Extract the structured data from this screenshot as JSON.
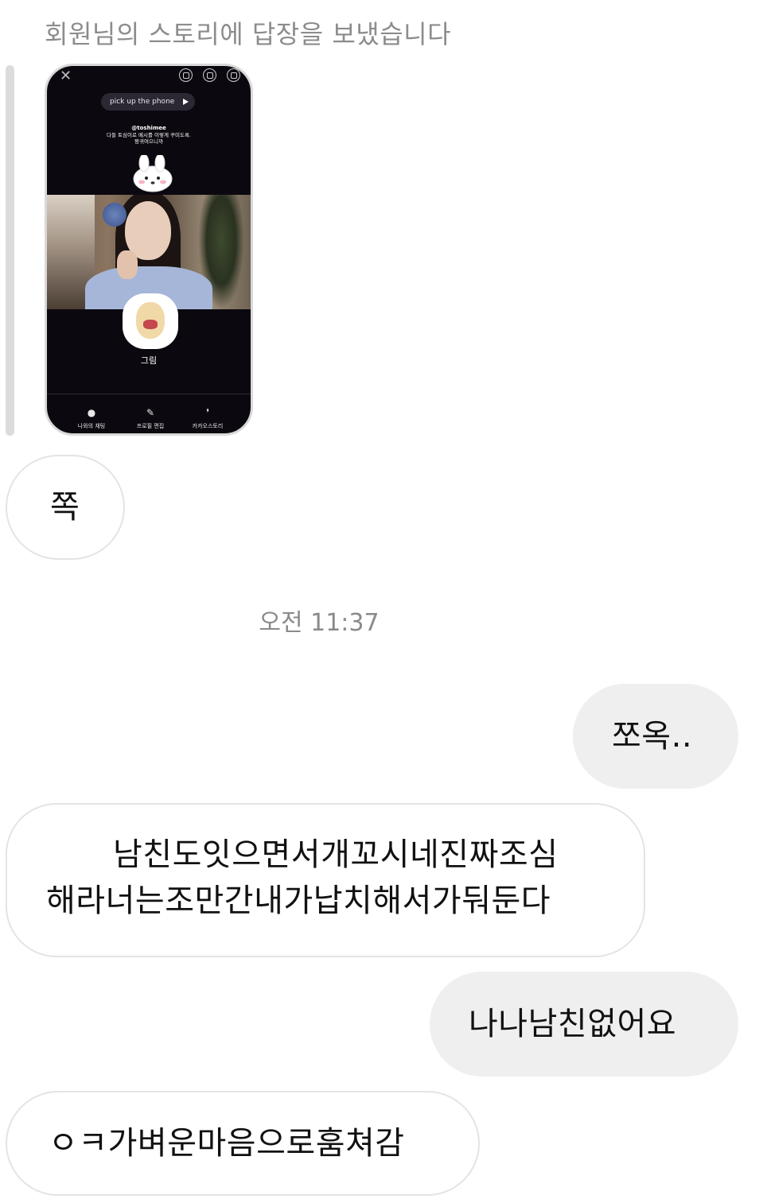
{
  "reply_notice": "회원님의 스토리에 답장을 보냈습니다",
  "story": {
    "close_icon": "close-icon",
    "top_icons": [
      "cube-icon",
      "scan-icon",
      "settings-icon"
    ],
    "music": "pick up the phone",
    "handle": "@toshimee",
    "bio_line1": "다들 토심이로 메시를 이렇게 꾸미도록.",
    "bio_line2": "짱귀여으니까",
    "profile_name": "그림",
    "actions": [
      {
        "icon": "chat-icon",
        "label": "나와의 채팅"
      },
      {
        "icon": "edit-icon",
        "label": "프로필 편집"
      },
      {
        "icon": "quote-icon",
        "label": "카카오스토리"
      }
    ]
  },
  "messages": [
    {
      "direction": "in",
      "text": "쪽"
    },
    {
      "type": "time",
      "text": "오전 11:37"
    },
    {
      "direction": "out",
      "text": "쪼옥.."
    },
    {
      "direction": "in",
      "line1": "남친도잇으면서개꼬시네진짜조심",
      "line2": "해라너는조만간내가납치해서가둬둔다"
    },
    {
      "direction": "out",
      "text": "나나남친없어요"
    },
    {
      "direction": "in",
      "text": "ㅇㅋ가벼운마음으로훔쳐감"
    }
  ],
  "colors": {
    "incoming_bubble_bg": "#ffffff",
    "incoming_bubble_border": "#e4e4e4",
    "outgoing_bubble_bg": "#efefef",
    "muted_text": "#8c8c8c",
    "story_bg": "#0b0810"
  }
}
